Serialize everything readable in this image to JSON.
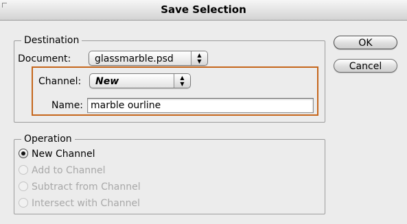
{
  "window": {
    "title": "Save Selection"
  },
  "destination": {
    "legend": "Destination",
    "document_label": "Document:",
    "document_value": "glassmarble.psd",
    "channel_label": "Channel:",
    "channel_value": "New",
    "name_label": "Name:",
    "name_value": "marble ourline",
    "highlight_color": "#c5651a"
  },
  "operation": {
    "legend": "Operation",
    "options": [
      {
        "label": "New Channel",
        "selected": true,
        "enabled": true
      },
      {
        "label": "Add to Channel",
        "selected": false,
        "enabled": false
      },
      {
        "label": "Subtract from Channel",
        "selected": false,
        "enabled": false
      },
      {
        "label": "Intersect with Channel",
        "selected": false,
        "enabled": false
      }
    ]
  },
  "buttons": {
    "ok": "OK",
    "cancel": "Cancel"
  },
  "icons": {
    "popup_arrows": "up-down-arrows-icon"
  }
}
